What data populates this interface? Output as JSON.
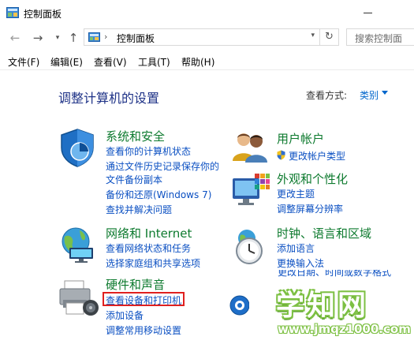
{
  "window": {
    "title": "控制面板"
  },
  "address": {
    "path": "控制面板",
    "separator": "›",
    "search_placeholder": "搜索控制面"
  },
  "menu": [
    "文件(F)",
    "编辑(E)",
    "查看(V)",
    "工具(T)",
    "帮助(H)"
  ],
  "main": {
    "heading": "调整计算机的设置",
    "view_by_label": "查看方式:",
    "view_by_value": "类别"
  },
  "categories": {
    "system": {
      "title": "系统和安全",
      "links": [
        "查看你的计算机状态",
        "通过文件历史记录保存你的",
        "文件备份副本",
        "备份和还原(Windows 7)",
        "查找并解决问题"
      ]
    },
    "users": {
      "title": "用户帐户",
      "links": [
        "更改帐户类型"
      ]
    },
    "appearance": {
      "title": "外观和个性化",
      "links": [
        "更改主题",
        "调整屏幕分辨率"
      ]
    },
    "network": {
      "title": "网络和 Internet",
      "links": [
        "查看网络状态和任务",
        "选择家庭组和共享选项"
      ]
    },
    "clock": {
      "title": "时钟、语言和区域",
      "links": [
        "添加语言",
        "更换输入法",
        "更改日期、时间或数字格式"
      ]
    },
    "hardware": {
      "title": "硬件和声音",
      "links": [
        "查看设备和打印机",
        "添加设备",
        "调整常用移动设置"
      ]
    }
  },
  "watermark": {
    "text": "学知网",
    "url": "www.jmqz1000.com"
  },
  "colors": {
    "heading": "#1e3287",
    "category": "#0d7a2e",
    "link": "#0a4fc2",
    "highlight": "#e0201f",
    "watermark": "#7dc043"
  }
}
